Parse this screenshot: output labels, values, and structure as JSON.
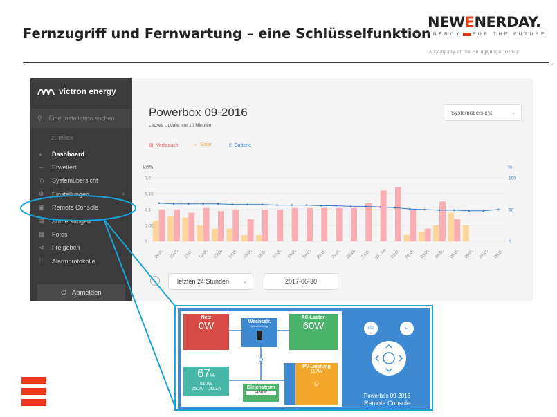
{
  "slide": {
    "title": "Fernzugriff und Fernwartung – eine Schlüsselfunktion",
    "logo_prefix": "NEW",
    "logo_e": "E",
    "logo_suffix": "NERDAY.",
    "logo_tag_left": "ENERGY",
    "logo_tag_right": "FOR THE FUTURE",
    "logo_sub": "A Company of the ElringKlinger Group",
    "brand_color": "#e73c17"
  },
  "vrm": {
    "brand": "victron energy",
    "search_placeholder": "Eine Installation suchen",
    "back_label": "ZURÜCK",
    "menu": [
      {
        "label": "Dashboard",
        "icon": "gauge-icon",
        "active": true
      },
      {
        "label": "Erweitert",
        "icon": "chart-icon",
        "active": false
      },
      {
        "label": "Systemübersicht",
        "icon": "location-icon",
        "active": false
      },
      {
        "label": "Einstellungen",
        "icon": "gear-icon",
        "active": false
      },
      {
        "label": "Remote Console",
        "icon": "console-icon",
        "active": false
      },
      {
        "label": "Anmerkungen",
        "icon": "note-icon",
        "active": false
      },
      {
        "label": "Fotos",
        "icon": "photo-icon",
        "active": false
      },
      {
        "label": "Freigeben",
        "icon": "share-icon",
        "active": false
      },
      {
        "label": "Alarmprotokolle",
        "icon": "alarm-icon",
        "active": false
      }
    ],
    "logout_label": "Abmelden",
    "title": "Powerbox 09-2016",
    "last_update": "Letztes Update: vor 10 Minuten",
    "view_select": "Systemübersicht",
    "legend": [
      "Verbrauch",
      "Solar",
      "Batterie"
    ],
    "range_select": "letzten 24 Stunden",
    "date_value": "2017-06-30"
  },
  "chart_data": {
    "type": "bar",
    "left_unit": "kWh",
    "right_unit": "%",
    "y_ticks": [
      "0.2",
      "0.15",
      "0.1",
      "0.05",
      "0"
    ],
    "y2_ticks": [
      "100",
      "50",
      "0"
    ],
    "ylim": [
      0,
      0.2
    ],
    "y2lim": [
      0,
      100
    ],
    "categories": [
      "09:00",
      "10:00",
      "11:00",
      "12:00",
      "13:00",
      "14:00",
      "15:00",
      "16:00",
      "17:00",
      "18:00",
      "19:00",
      "20:00",
      "21:00",
      "22:00",
      "23:00",
      "30. Jun",
      "01:00",
      "02:00",
      "03:00",
      "04:00",
      "05:00",
      "06:00",
      "07:00",
      "08:00"
    ],
    "series": [
      {
        "name": "Verbrauch",
        "color": "#f9aeb3",
        "values": [
          0.1,
          0.1,
          0.09,
          0.105,
          0.095,
          0.1,
          0.07,
          0.1,
          0.1,
          0.105,
          0.105,
          0.105,
          0.105,
          0.105,
          0.12,
          0.16,
          0.17,
          0.1,
          0.04,
          0.125,
          0.07,
          0,
          0,
          0
        ]
      },
      {
        "name": "Solar",
        "color": "#fbd59b",
        "values": [
          0.065,
          0.08,
          0.075,
          0.05,
          0.04,
          0.04,
          0.02,
          0.02,
          0,
          0,
          0,
          0,
          0,
          0,
          0,
          0,
          0,
          0.02,
          0.03,
          0.05,
          0.09,
          0.05,
          0,
          0
        ]
      },
      {
        "name": "Batterie",
        "color": "#3c7fc7",
        "values": [
          60,
          59,
          59,
          59,
          59,
          58,
          58,
          58,
          57,
          57,
          57,
          56,
          56,
          55,
          55,
          54,
          53,
          51,
          50,
          49,
          49,
          48,
          48,
          50
        ]
      }
    ]
  },
  "console": {
    "netz_title": "Netz",
    "netz_value": "0W",
    "inverter_title": "Wechselr.",
    "inverter_brand": "victron energy",
    "ac_title": "AC-Lasten",
    "ac_value": "60W",
    "battery_value": "67",
    "battery_unit": "%",
    "battery_power": "510W",
    "battery_detail": "25.2V · 20.3A",
    "dc_title": "Gleichstrom",
    "dc_value": "-488W",
    "pv_title": "PV-Leistung",
    "pv_value": "117W",
    "esc_label": "esc",
    "device_name": "Powerbox 09-2016",
    "console_label": "Remote Console"
  }
}
